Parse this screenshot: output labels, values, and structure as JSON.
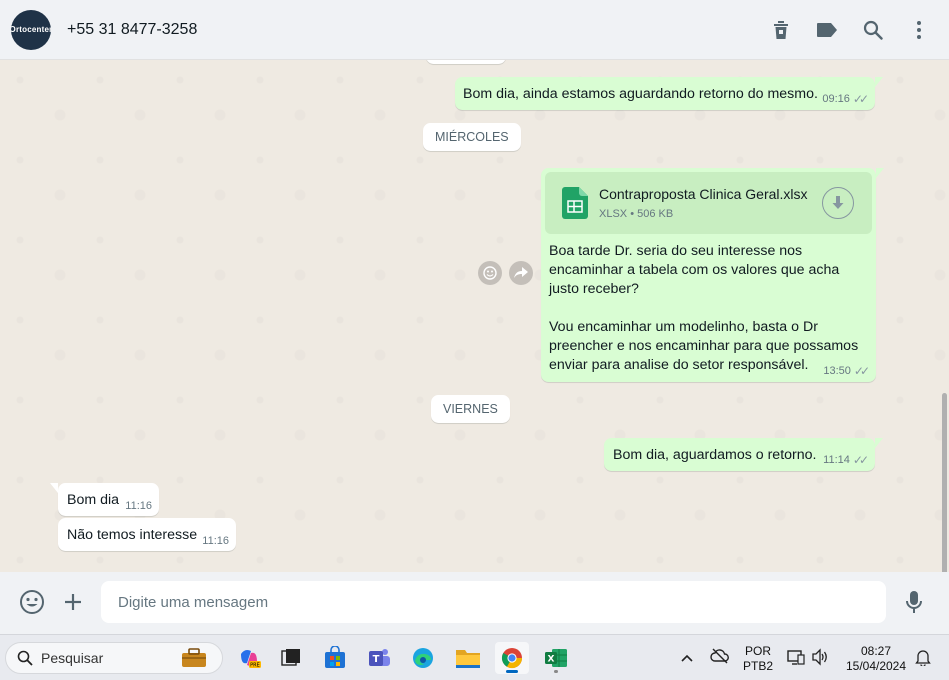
{
  "header": {
    "avatar_text": "Ortocenter",
    "contact": "+55 31 8477-3258",
    "icons": [
      "delete-icon",
      "label-icon",
      "search-icon",
      "menu-icon"
    ]
  },
  "chat": {
    "messages": [
      {
        "dir": "out",
        "text": "Bom dia, ainda estamos aguardando retorno do mesmo.",
        "time": "09:16",
        "ticks": "✓✓"
      },
      {
        "dir": "day",
        "text": "MIÉRCOLES"
      },
      {
        "dir": "out",
        "type": "document",
        "file_name": "Contraproposta Clinica Geral.xlsx",
        "file_type": "XLSX",
        "file_size": "506 KB",
        "text": "Boa tarde Dr. seria do seu interesse nos encaminhar a tabela com os valores que acha justo receber?\n\nVou encaminhar um modelinho, basta o Dr preencher e nos encaminhar para que possamos enviar para analise do setor responsável.",
        "time": "13:50",
        "ticks": "✓✓"
      },
      {
        "dir": "day",
        "text": "VIERNES"
      },
      {
        "dir": "out",
        "text": "Bom dia, aguardamos o retorno.",
        "time": "11:14",
        "ticks": "✓✓"
      },
      {
        "dir": "in",
        "text": "Bom dia",
        "time": "11:16"
      },
      {
        "dir": "in",
        "text": "Não temos interesse",
        "time": "11:16"
      }
    ]
  },
  "composer": {
    "placeholder": "Digite uma mensagem"
  },
  "taskbar": {
    "search_label": "Pesquisar",
    "apps": [
      "copilot-app",
      "task-view-app",
      "store-app",
      "teams-app",
      "edge-app",
      "file-explorer-app",
      "chrome-app",
      "excel-app"
    ],
    "language": "POR",
    "keyboard": "PTB2",
    "time": "08:27",
    "date": "15/04/2024"
  },
  "colors": {
    "outgoing_bubble": "#d9fdd3",
    "incoming_bubble": "#ffffff",
    "chat_bg": "#efeae2",
    "header_bg": "#f0f2f5",
    "excel_green": "#21a366"
  }
}
